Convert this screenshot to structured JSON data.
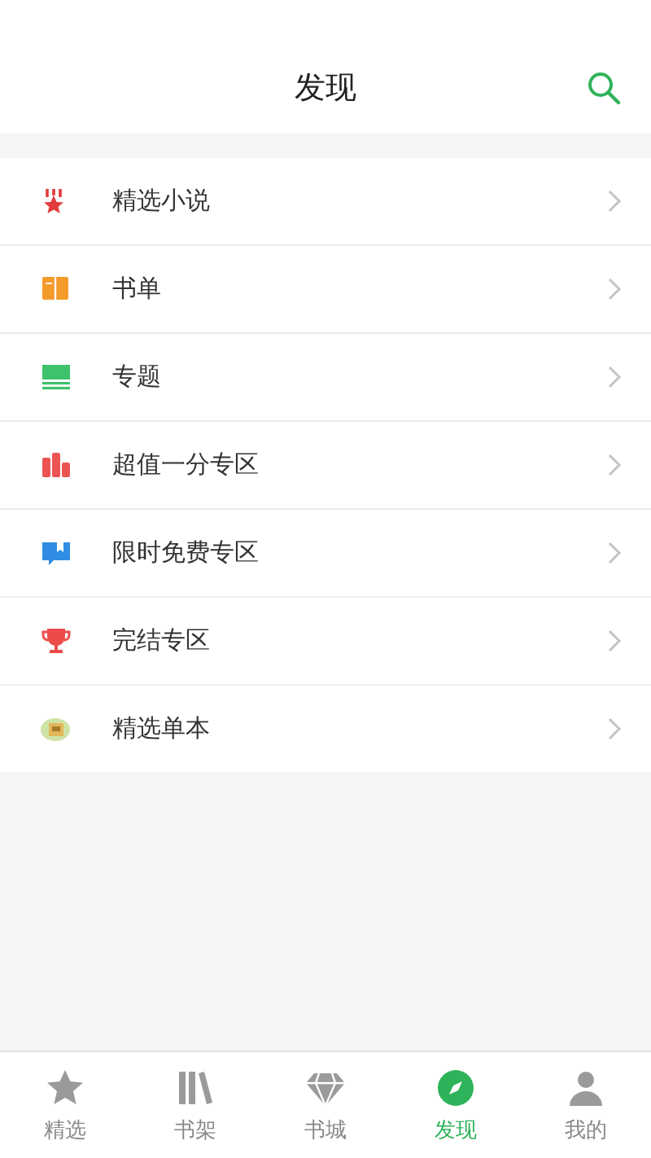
{
  "header": {
    "title": "发现"
  },
  "items": [
    {
      "label": "精选小说"
    },
    {
      "label": "书单"
    },
    {
      "label": "专题"
    },
    {
      "label": "超值一分专区"
    },
    {
      "label": "限时免费专区"
    },
    {
      "label": "完结专区"
    },
    {
      "label": "精选单本"
    }
  ],
  "tabs": [
    {
      "label": "精选",
      "selected": false
    },
    {
      "label": "书架",
      "selected": false
    },
    {
      "label": "书城",
      "selected": false
    },
    {
      "label": "发现",
      "selected": true
    },
    {
      "label": "我的",
      "selected": false
    }
  ]
}
